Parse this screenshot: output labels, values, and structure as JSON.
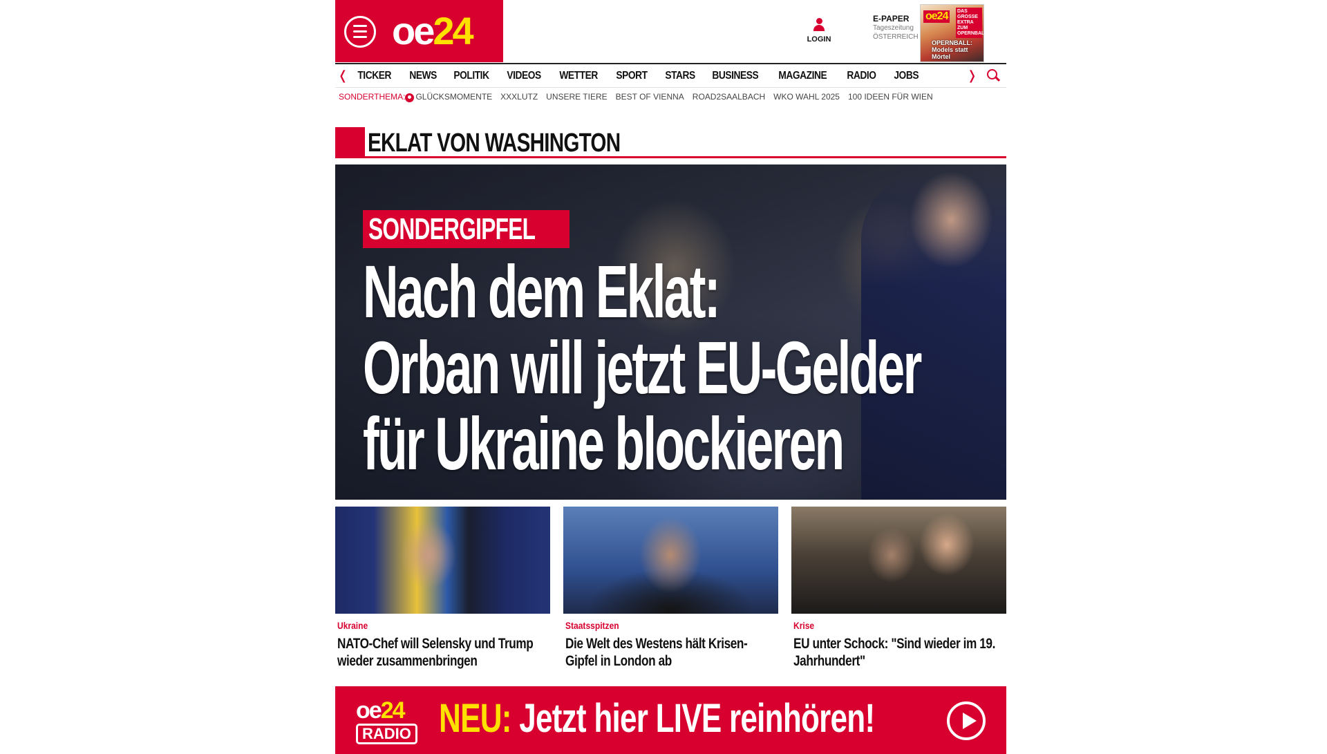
{
  "header": {
    "logo_oe": "oe",
    "logo_24": "24",
    "login_label": "LOGIN",
    "epaper_title": "E-PAPER",
    "epaper_line1": "Tageszeitung",
    "epaper_line2": "ÖSTERREICH",
    "epaper_cover_logo": "oe24",
    "epaper_cover_tag": "DAS GROSSE EXTRA ZUM OPERNBALL",
    "epaper_cover_headline": "OPERNBALL: Models statt Mörtel"
  },
  "nav": {
    "items": [
      "TICKER",
      "NEWS",
      "POLITIK",
      "VIDEOS",
      "WETTER",
      "SPORT",
      "STARS",
      "BUSINESS",
      "MAGAZINE",
      "RADIO",
      "JOBS"
    ]
  },
  "subnav": {
    "label": "SONDERTHEMA:",
    "items": [
      "GLÜCKSMOMENTE",
      "XXXLUTZ",
      "UNSERE TIERE",
      "BEST OF VIENNA",
      "ROAD2SAALBACH",
      "WKO WAHL 2025",
      "100 IDEEN FÜR WIEN"
    ]
  },
  "section": {
    "title": "EKLAT VON WASHINGTON"
  },
  "hero": {
    "kicker": "SONDERGIPFEL",
    "title_lines": [
      "Nach dem Eklat:",
      "Orban will jetzt EU-Gelder",
      "für Ukraine blockieren"
    ]
  },
  "teasers": [
    {
      "category": "Ukraine",
      "title": "NATO-Chef will Selensky und Trump wieder zusammenbringen"
    },
    {
      "category": "Staatsspitzen",
      "title": "Die Welt des Westens hält Krisen-Gipfel in London ab"
    },
    {
      "category": "Krise",
      "title": "EU unter Schock: \"Sind wieder im 19. Jahrhundert\""
    }
  ],
  "radio_banner": {
    "logo_top_oe": "oe",
    "logo_top_24": "24",
    "logo_bottom": "RADIO",
    "neu": "NEU:",
    "text": " Jetzt hier LIVE reinhören!"
  },
  "colors": {
    "brand_red": "#d8002f",
    "brand_yellow": "#ffe100"
  },
  "icons": {
    "menu": "hamburger-menu-icon",
    "login": "user-icon",
    "search": "search-icon",
    "nav_left": "chevron-left-icon",
    "nav_right": "chevron-right-icon",
    "play": "play-icon"
  }
}
